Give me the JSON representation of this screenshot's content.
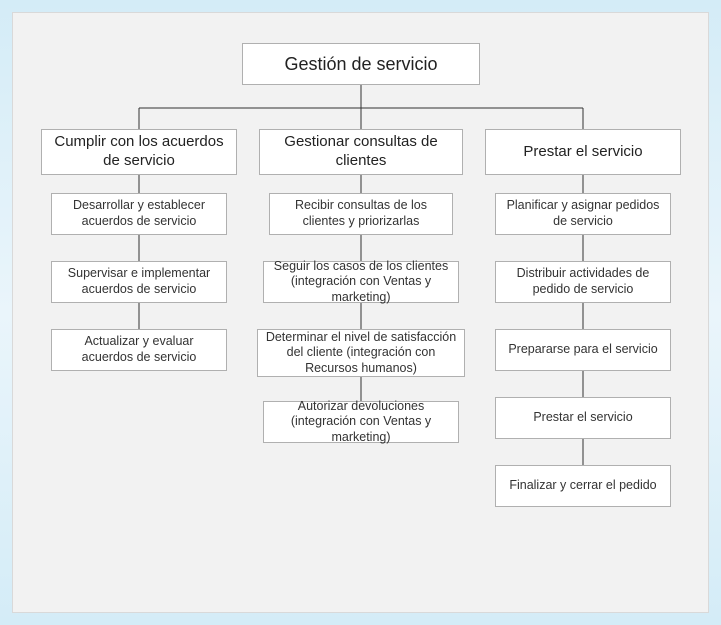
{
  "root": {
    "label": "Gestión de servicio"
  },
  "cols": [
    {
      "title": "Cumplir con los acuerdos de servicio",
      "steps": [
        "Desarrollar y establecer acuerdos de servicio",
        "Supervisar e implementar acuerdos de servicio",
        "Actualizar y evaluar acuerdos de servicio"
      ]
    },
    {
      "title": "Gestionar consultas de clientes",
      "steps": [
        "Recibir consultas de los clientes y priorizarlas",
        "Seguir los casos de los clientes (integración con Ventas y marketing)",
        "Determinar el nivel de satisfacción del cliente (integración con Recursos humanos)",
        "Autorizar devoluciones (integración con Ventas y marketing)"
      ]
    },
    {
      "title": "Prestar el servicio",
      "steps": [
        "Planificar y asignar pedidos de servicio",
        "Distribuir actividades de pedido de servicio",
        "Prepararse para el servicio",
        "Prestar el servicio",
        "Finalizar y cerrar el pedido"
      ]
    }
  ]
}
